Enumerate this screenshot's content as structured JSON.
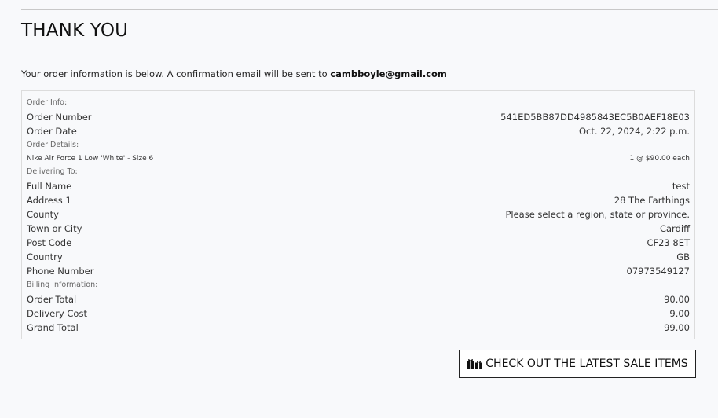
{
  "page": {
    "title": "THANK YOU",
    "intro_text": "Your order information is below. A confirmation email will be sent to ",
    "email": "cambboyle@gmail.com"
  },
  "order_info": {
    "heading": "Order Info:",
    "order_number_label": "Order Number",
    "order_number_value": "541ED5BB87DD4985843EC5B0AEF18E03",
    "order_date_label": "Order Date",
    "order_date_value": "Oct. 22, 2024, 2:22 p.m."
  },
  "order_details": {
    "heading": "Order Details:",
    "item_name": "Nike Air Force 1 Low 'White' - Size 6",
    "item_qty_price": "1 @ $90.00 each"
  },
  "delivering_to": {
    "heading": "Delivering To:",
    "rows": [
      {
        "label": "Full Name",
        "value": "test"
      },
      {
        "label": "Address 1",
        "value": "28 The Farthings"
      },
      {
        "label": "County",
        "value": "Please select a region, state or province."
      },
      {
        "label": "Town or City",
        "value": "Cardiff"
      },
      {
        "label": "Post Code",
        "value": "CF23 8ET"
      },
      {
        "label": "Country",
        "value": "GB"
      },
      {
        "label": "Phone Number",
        "value": "07973549127"
      }
    ]
  },
  "billing": {
    "heading": "Billing Information:",
    "rows": [
      {
        "label": "Order Total",
        "value": "90.00"
      },
      {
        "label": "Delivery Cost",
        "value": "9.00"
      },
      {
        "label": "Grand Total",
        "value": "99.00"
      }
    ]
  },
  "cta": {
    "icon": "gifts-icon",
    "label": "CHECK OUT THE LATEST SALE ITEMS"
  }
}
